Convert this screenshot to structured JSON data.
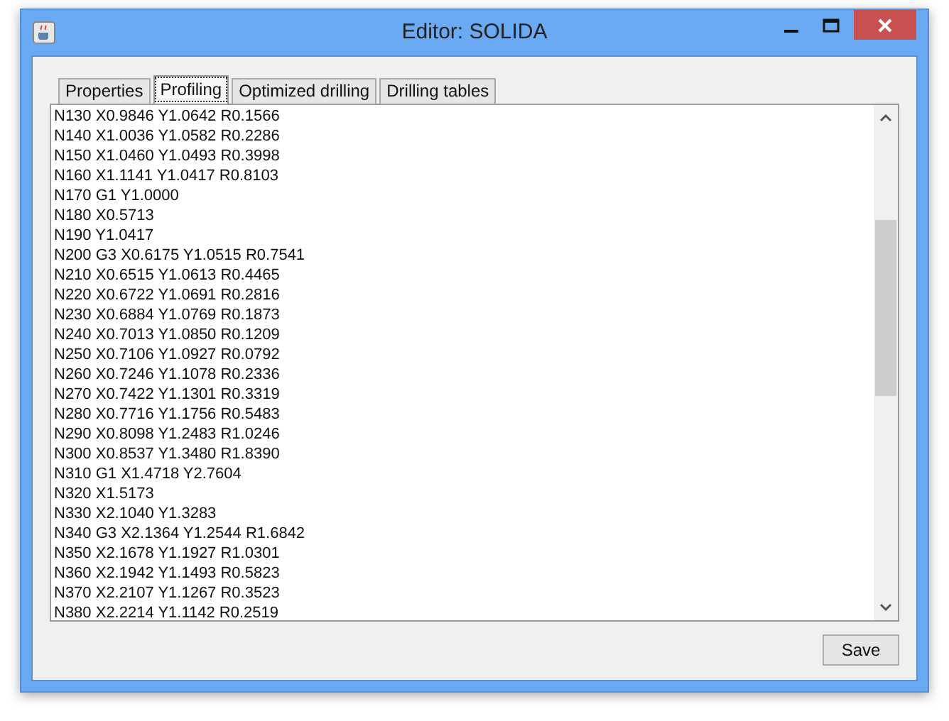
{
  "window": {
    "title": "Editor: SOLIDA"
  },
  "tabs": [
    {
      "label": "Properties",
      "selected": false
    },
    {
      "label": "Profiling",
      "selected": true
    },
    {
      "label": "Optimized drilling",
      "selected": false
    },
    {
      "label": "Drilling tables",
      "selected": false
    }
  ],
  "editor": {
    "lines": [
      "N130 X0.9846 Y1.0642 R0.1566",
      "N140 X1.0036 Y1.0582 R0.2286",
      "N150 X1.0460 Y1.0493 R0.3998",
      "N160 X1.1141 Y1.0417 R0.8103",
      "N170 G1 Y1.0000",
      "N180 X0.5713",
      "N190 Y1.0417",
      "N200 G3 X0.6175 Y1.0515 R0.7541",
      "N210 X0.6515 Y1.0613 R0.4465",
      "N220 X0.6722 Y1.0691 R0.2816",
      "N230 X0.6884 Y1.0769 R0.1873",
      "N240 X0.7013 Y1.0850 R0.1209",
      "N250 X0.7106 Y1.0927 R0.0792",
      "N260 X0.7246 Y1.1078 R0.2336",
      "N270 X0.7422 Y1.1301 R0.3319",
      "N280 X0.7716 Y1.1756 R0.5483",
      "N290 X0.8098 Y1.2483 R1.0246",
      "N300 X0.8537 Y1.3480 R1.8390",
      "N310 G1 X1.4718 Y2.7604",
      "N320 X1.5173",
      "N330 X2.1040 Y1.3283",
      "N340 G3 X2.1364 Y1.2544 R1.6842",
      "N350 X2.1678 Y1.1927 R1.0301",
      "N360 X2.1942 Y1.1493 R0.5823",
      "N370 X2.2107 Y1.1267 R0.3523",
      "N380 X2.2214 Y1.1142 R0.2519"
    ]
  },
  "buttons": [
    {
      "label": "Save"
    }
  ]
}
